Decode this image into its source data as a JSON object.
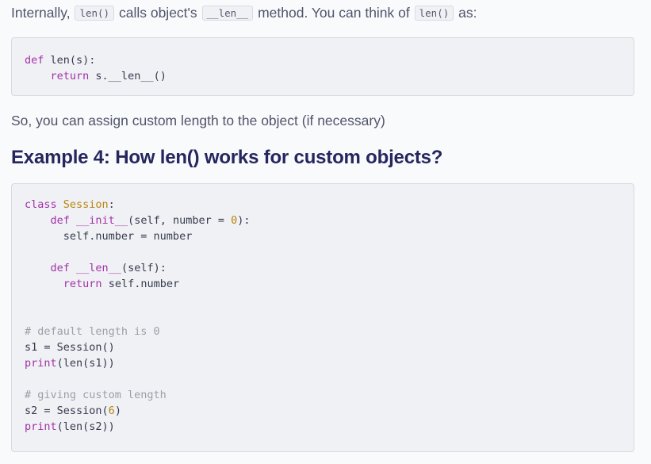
{
  "intro": {
    "t1": "Internally,",
    "c1": "len()",
    "t2": "calls object's",
    "c2": "__len__",
    "t3": "method. You can think of",
    "c3": "len()",
    "t4": "as:"
  },
  "code1": {
    "line1": {
      "kw": "def",
      "rest": " len(s):"
    },
    "line2": {
      "indent": "    ",
      "kw": "return",
      "rest": " s.__len__()"
    }
  },
  "para2": "So, you can assign custom length to the object (if necessary)",
  "heading": "Example 4: How len() works for custom objects?",
  "code2": {
    "l1": {
      "kw": "class",
      "cls": " Session",
      "rest": ":"
    },
    "l2": {
      "indent": "    ",
      "kw": "def",
      "fn": " __init__",
      "a": "(self, number = ",
      "num": "0",
      "b": "):"
    },
    "l3": {
      "text": "      self.number = number"
    },
    "l5": {
      "indent": "    ",
      "kw": "def",
      "fn": " __len__",
      "a": "(self):"
    },
    "l6": {
      "indent": "      ",
      "kw": "return",
      "rest": " self.number"
    },
    "l9": {
      "cmt": "# default length is 0"
    },
    "l10": {
      "text": "s1 = Session()"
    },
    "l11": {
      "fn": "print",
      "a": "(len(s1))"
    },
    "l13": {
      "cmt": "# giving custom length"
    },
    "l14": {
      "a": "s2 = Session(",
      "num": "6",
      "b": ")"
    },
    "l15": {
      "fn": "print",
      "a": "(len(s2))"
    }
  }
}
